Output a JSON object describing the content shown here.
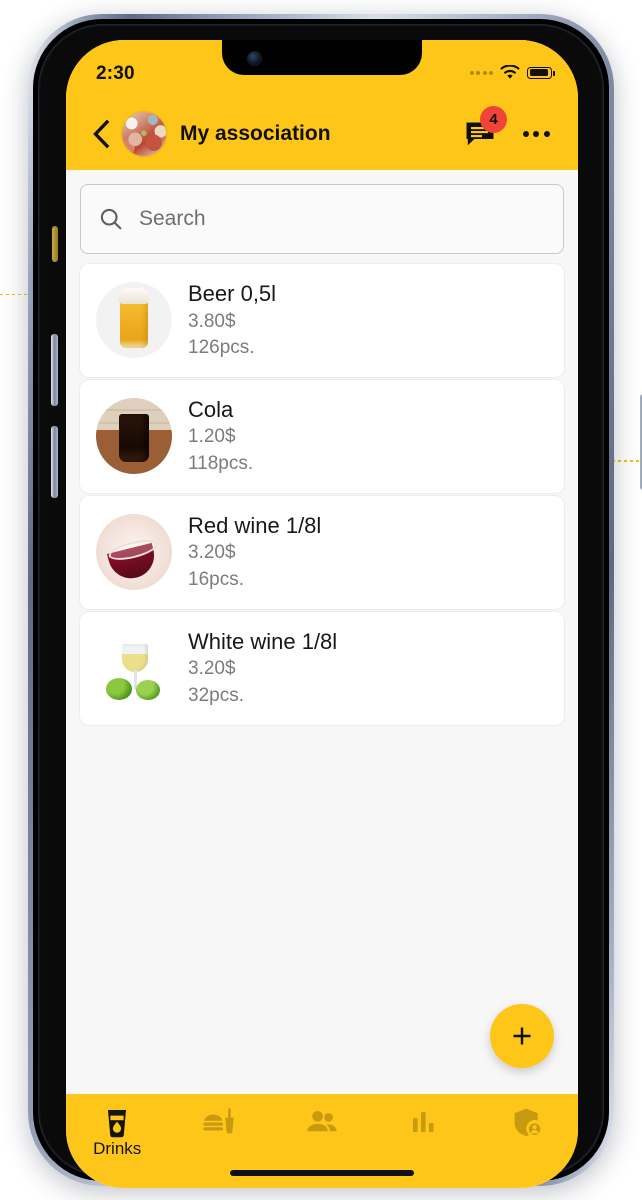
{
  "theme": {
    "brand": "#FFC61A",
    "badge": "#F04438",
    "screen_bg": "#F7F7F7",
    "card_bg": "#FFFFFF"
  },
  "status_bar": {
    "time": "2:30",
    "signal_icon": "signal-dots-icon",
    "wifi_icon": "wifi-icon",
    "battery_icon": "battery-full-icon"
  },
  "app_bar": {
    "back_icon": "back-chevron-icon",
    "avatar_icon": "group-avatar-image",
    "title": "My association",
    "chat_icon": "chat-bubble-icon",
    "chat_badge": "4",
    "overflow_icon": "more-horizontal-icon"
  },
  "search": {
    "icon": "search-icon",
    "placeholder": "Search",
    "value": ""
  },
  "list": {
    "items": [
      {
        "name": "Beer 0,5l",
        "price": "3.80$",
        "qty": "126pcs.",
        "thumb": "beer-glass-image"
      },
      {
        "name": "Cola",
        "price": "1.20$",
        "qty": "118pcs.",
        "thumb": "cola-glass-image"
      },
      {
        "name": "Red wine 1/8l",
        "price": "3.20$",
        "qty": "16pcs.",
        "thumb": "red-wine-glass-image"
      },
      {
        "name": "White wine 1/8l",
        "price": "3.20$",
        "qty": "32pcs.",
        "thumb": "white-wine-glass-image"
      }
    ]
  },
  "fab": {
    "icon": "plus-icon",
    "label": "+"
  },
  "bottom_nav": {
    "items": [
      {
        "label": "Drinks",
        "icon": "drink-glass-icon",
        "selected": true
      },
      {
        "label": "",
        "icon": "fast-food-icon",
        "selected": false
      },
      {
        "label": "",
        "icon": "people-group-icon",
        "selected": false
      },
      {
        "label": "",
        "icon": "bar-chart-icon",
        "selected": false
      },
      {
        "label": "",
        "icon": "shield-account-icon",
        "selected": false
      }
    ]
  }
}
